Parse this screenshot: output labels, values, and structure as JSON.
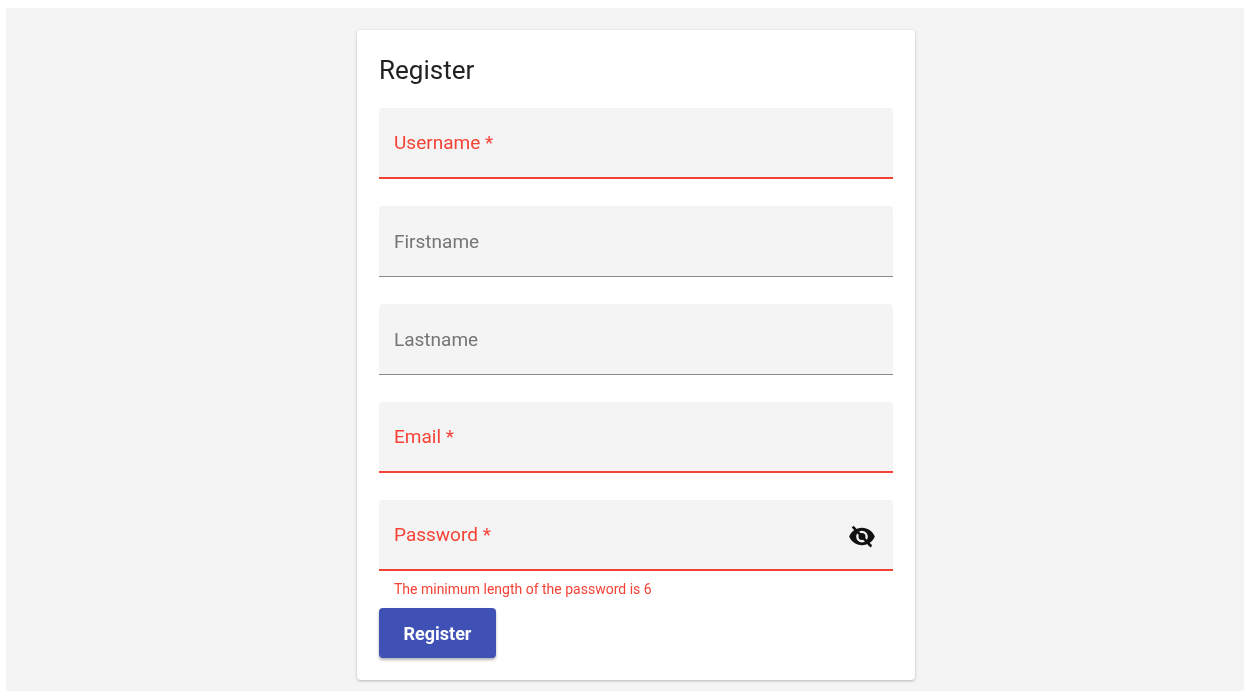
{
  "card": {
    "title": "Register",
    "fields": [
      {
        "placeholder": "Username *",
        "invalid": true
      },
      {
        "placeholder": "Firstname",
        "invalid": false
      },
      {
        "placeholder": "Lastname",
        "invalid": false
      },
      {
        "placeholder": "Email *",
        "invalid": true
      },
      {
        "placeholder": "Password *",
        "invalid": true,
        "kind": "password",
        "password_visible": false,
        "error": "The minimum length of the password is 6"
      }
    ],
    "button": "Register"
  }
}
